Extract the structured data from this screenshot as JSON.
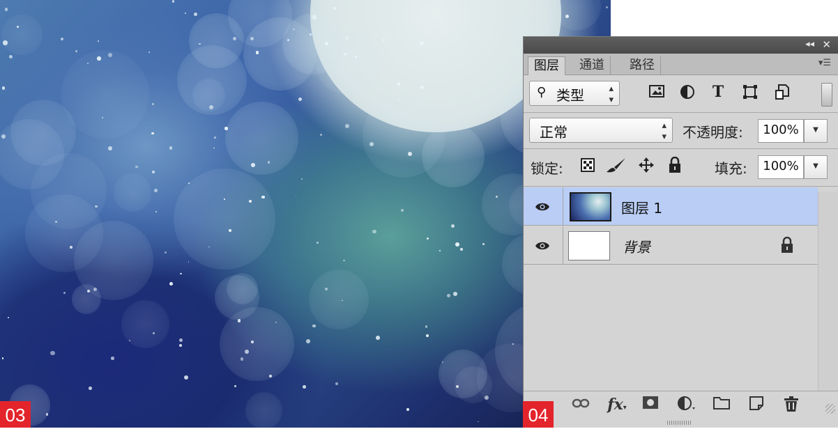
{
  "badges": {
    "left": "03",
    "right": "04"
  },
  "panel": {
    "titlebar": {
      "collapse_icon": "double-chevron-left",
      "close_icon": "close"
    },
    "tabs": [
      {
        "label": "图层",
        "active": true
      },
      {
        "label": "通道",
        "active": false
      },
      {
        "label": "路径",
        "active": false
      }
    ],
    "filter": {
      "kind_label": "类型",
      "icons": [
        "image-filter",
        "adjustment-filter",
        "type-filter",
        "shape-filter",
        "smart-object-filter"
      ]
    },
    "blend": {
      "mode": "正常",
      "opacity_label": "不透明度:",
      "opacity_value": "100%"
    },
    "lock": {
      "label": "锁定:",
      "icons": [
        "lock-transparent-pixels",
        "lock-image-pixels",
        "lock-position",
        "lock-all"
      ],
      "fill_label": "填充:",
      "fill_value": "100%"
    },
    "layers": [
      {
        "name": "图层 1",
        "visible": true,
        "selected": true,
        "locked": false
      },
      {
        "name": "背景",
        "visible": true,
        "selected": false,
        "locked": true
      }
    ],
    "bottom_icons": [
      "link-layers",
      "fx",
      "add-mask",
      "adjustment-layer",
      "new-group",
      "new-layer",
      "delete-layer"
    ]
  },
  "colors": {
    "selected_layer": "#b9cdf5",
    "badge": "#e3242b",
    "panel_bg": "#d4d4d4"
  }
}
